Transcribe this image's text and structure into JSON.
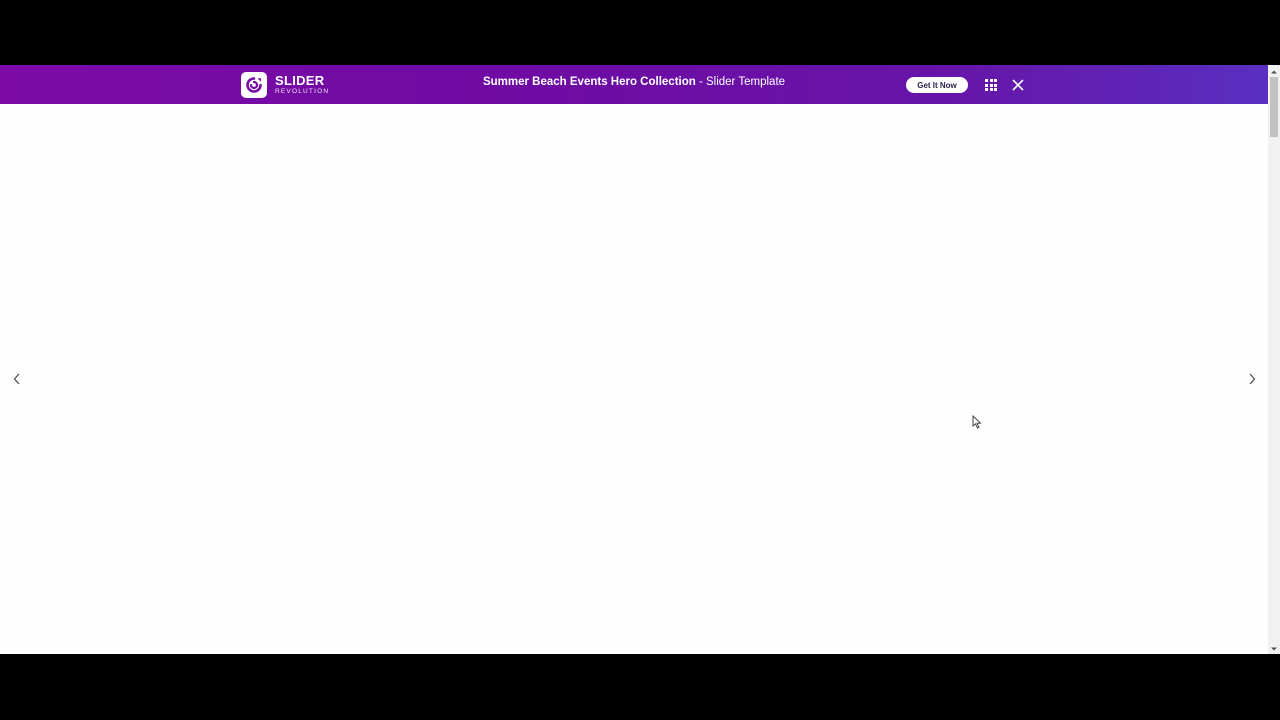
{
  "promo_bar": {
    "logo": {
      "word": "SLIDER",
      "sub": "REVOLUTION"
    },
    "title_strong": "Summer Beach Events Hero Collection",
    "title_rest": " - Slider Template",
    "cta_label": "Get It Now",
    "menu_icon": "grid-icon",
    "close_icon": "close-icon"
  },
  "slider": {
    "prev_icon": "chevron-left-icon",
    "next_icon": "chevron-right-icon"
  },
  "colors": {
    "bar_start": "#7d0aa6",
    "bar_end": "#5a2fc0",
    "cta_text": "#2b1d4d",
    "page_bg": "#fefefe"
  }
}
